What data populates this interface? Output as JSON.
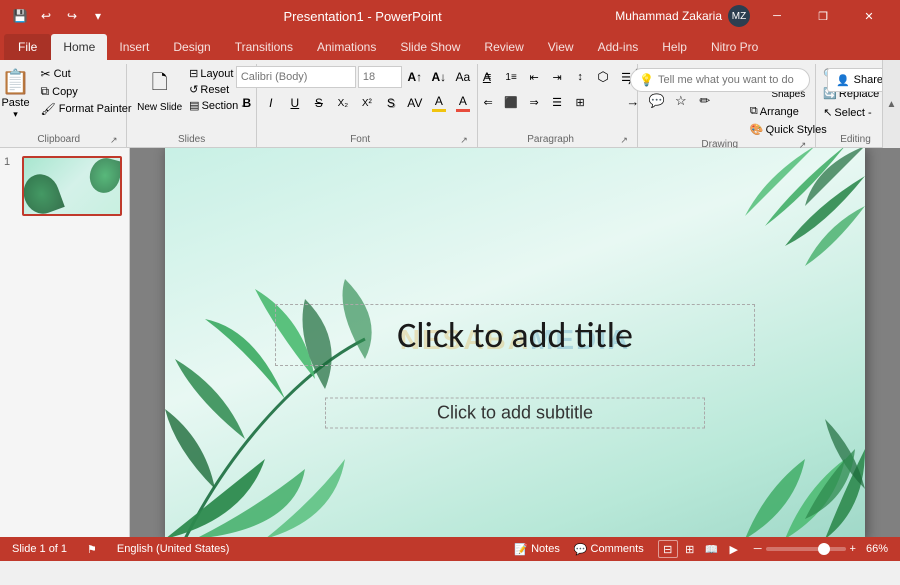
{
  "titleBar": {
    "title": "Presentation1 - PowerPoint",
    "quickAccess": [
      "save",
      "undo",
      "redo",
      "customize"
    ],
    "user": "Muhammad Zakaria",
    "userInitials": "MZ",
    "windowControls": [
      "minimize",
      "restore",
      "close"
    ]
  },
  "ribbonTabs": {
    "tabs": [
      "File",
      "Home",
      "Insert",
      "Design",
      "Transitions",
      "Animations",
      "Slide Show",
      "Review",
      "View",
      "Add-ins",
      "Help",
      "Nitro Pro"
    ],
    "activeTab": "Home"
  },
  "ribbon": {
    "clipboard": {
      "label": "Clipboard",
      "paste": "Paste",
      "cut": "Cut",
      "copy": "Copy",
      "formatPainter": "Format Painter"
    },
    "slides": {
      "label": "Slides",
      "newSlide": "New Slide",
      "layout": "Layout",
      "reset": "Reset",
      "section": "Section -"
    },
    "font": {
      "label": "Font",
      "fontName": "",
      "fontSize": "",
      "bold": "B",
      "italic": "I",
      "underline": "U",
      "strikethrough": "S",
      "shadowText": "S",
      "formatClear": "A",
      "increaseFontSize": "A",
      "decreaseFontSize": "A",
      "changeCase": "Aa",
      "fontColor": "A",
      "textHighlight": "A"
    },
    "paragraph": {
      "label": "Paragraph",
      "bulletList": "≡",
      "numberedList": "≡",
      "decreaseIndent": "⇤",
      "increaseIndent": "⇥",
      "alignLeft": "≡",
      "alignCenter": "≡",
      "alignRight": "≡",
      "justify": "≡",
      "columnLayout": "⊞",
      "textDirection": "↕",
      "convertToSmartArt": "⬡",
      "lineSpacing": "≡"
    },
    "drawing": {
      "label": "Drawing",
      "shapes": "Shapes",
      "arrange": "Arrange",
      "quickStyles": "Quick Styles"
    },
    "editing": {
      "label": "Editing",
      "find": "Find",
      "replace": "Replace ▾",
      "select": "Select -"
    },
    "tellMe": {
      "placeholder": "Tell me what you want to do",
      "icon": "lightbulb"
    },
    "share": "Share",
    "nitro": "Nitro Pro"
  },
  "slidePanel": {
    "slides": [
      {
        "number": 1,
        "active": true
      }
    ]
  },
  "slide": {
    "watermark": {
      "part1": "NESABA",
      "part2": "MEDIA"
    },
    "titlePlaceholder": "Click to add title",
    "subtitlePlaceholder": "Click to add subtitle"
  },
  "statusBar": {
    "slideInfo": "Slide 1 of 1",
    "language": "English (United States)",
    "notes": "Notes",
    "comments": "Comments",
    "zoom": "66%",
    "viewButtons": [
      "normal",
      "slidesorter",
      "readingview",
      "slideshow"
    ]
  }
}
